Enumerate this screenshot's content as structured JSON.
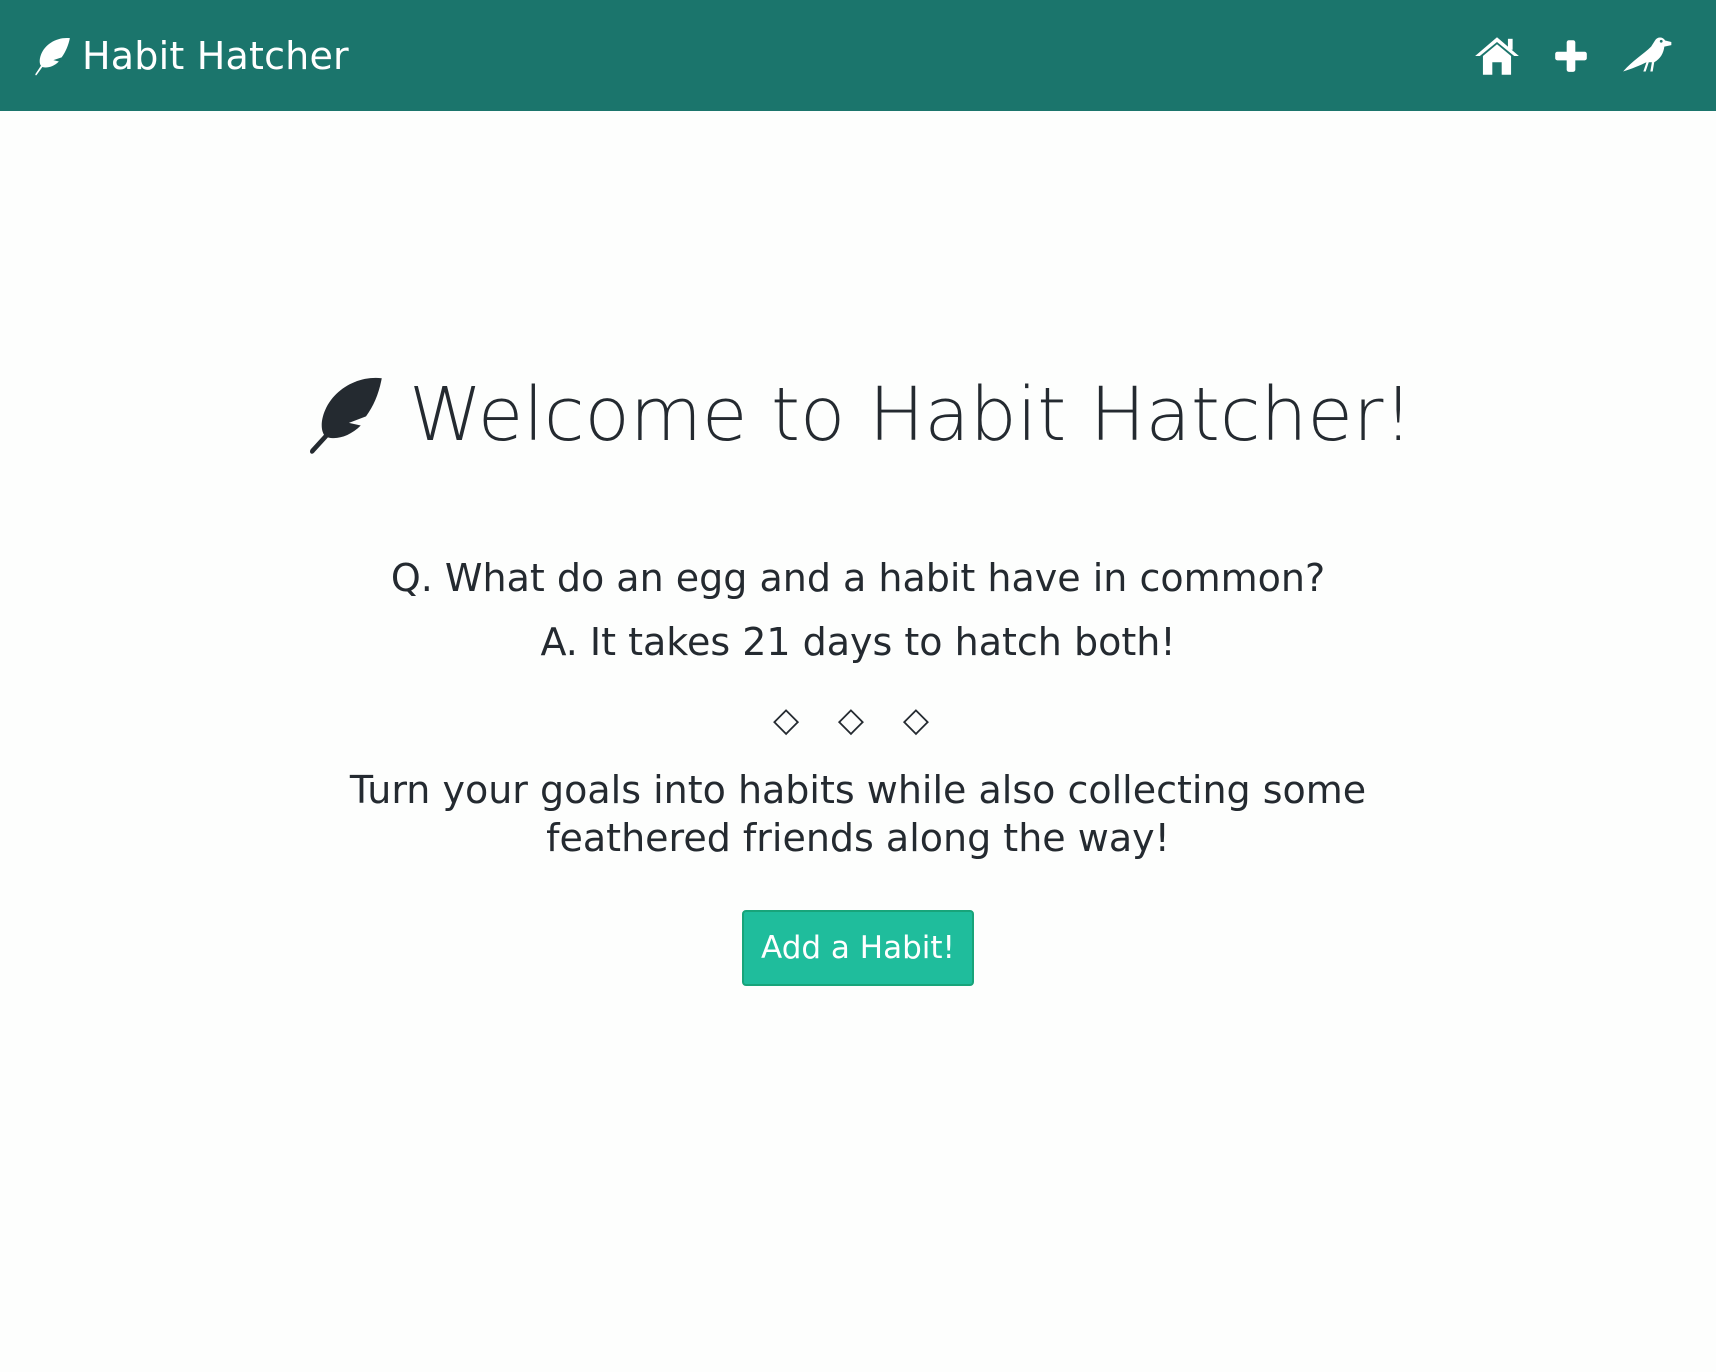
{
  "navbar": {
    "brand_name": "Habit Hatcher",
    "brand_icon": "feather-icon",
    "background_color": "#1b756c",
    "nav_icons": [
      "home-icon",
      "plus-icon",
      "crow-icon"
    ]
  },
  "hero": {
    "title": "Welcome to Habit Hatcher!",
    "title_icon": "feather-icon",
    "question": "Q. What do an egg and a habit have in common?",
    "answer": "A. It takes 21 days to hatch both!",
    "divider": "◇ ◇ ◇",
    "tagline": "Turn your goals into habits while also collecting some feathered friends along the way!",
    "cta_label": "Add a Habit!",
    "cta_color": "#1fbd9c"
  }
}
